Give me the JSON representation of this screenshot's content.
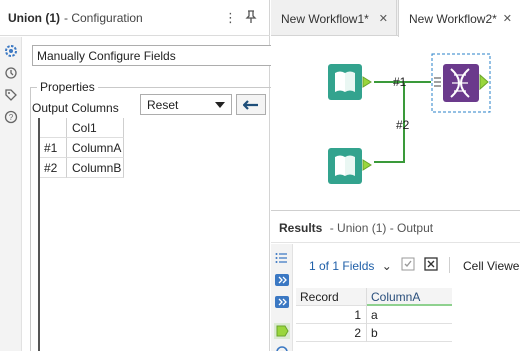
{
  "config": {
    "title": "Union (1)",
    "subtitle": "- Configuration",
    "mode_value": "Manually Configure Fields",
    "properties_label": "Properties",
    "output_columns_label": "Output Columns",
    "reset_value": "Reset",
    "grid": {
      "header": [
        "",
        "Col1"
      ],
      "rows": [
        [
          "#1",
          "ColumnA"
        ],
        [
          "#2",
          "ColumnB"
        ]
      ]
    }
  },
  "tabs": [
    {
      "label": "New Workflow1*",
      "active": false
    },
    {
      "label": "New Workflow2*",
      "active": true
    }
  ],
  "canvas": {
    "connection_labels": [
      "#1",
      "#2"
    ],
    "accent_color": "#33a38e",
    "union_color": "#6b3a8c"
  },
  "results": {
    "title": "Results",
    "subtitle": "- Union (1) - Output",
    "fields_count": "1 of 1 Fields",
    "cell_viewer": "Cell Viewer",
    "columns": [
      "Record",
      "ColumnA"
    ],
    "rows": [
      [
        "1",
        "a"
      ],
      [
        "2",
        "b"
      ]
    ]
  }
}
